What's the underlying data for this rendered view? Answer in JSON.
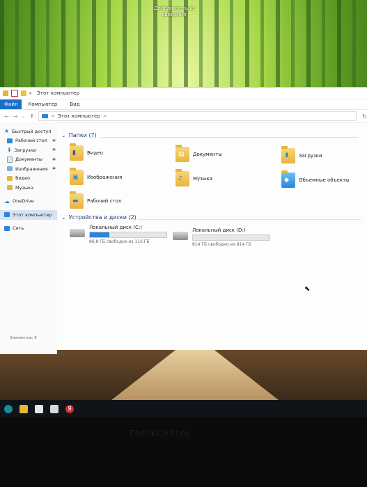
{
  "desktop": {
    "label": "Дополнительно сведения"
  },
  "window": {
    "title": "Этот компьютер",
    "ribbon": {
      "file": "Файл",
      "tabs": [
        "Компьютер",
        "Вид"
      ]
    },
    "address": {
      "path": "Этот компьютер",
      "sep": ">"
    },
    "status": "Элементов: 9"
  },
  "sidebar": {
    "quick_access": "Быстрый доступ",
    "pinned": [
      {
        "label": "Рабочий стол",
        "icon": "desktop-icon"
      },
      {
        "label": "Загрузки",
        "icon": "download-icon"
      },
      {
        "label": "Документы",
        "icon": "documents-icon"
      },
      {
        "label": "Изображения",
        "icon": "pictures-icon"
      },
      {
        "label": "Видео",
        "icon": "video-icon"
      },
      {
        "label": "Музыка",
        "icon": "music-icon"
      }
    ],
    "onedrive": "OneDrive",
    "this_pc": "Этот компьютер",
    "network": "Сеть"
  },
  "folders_section": {
    "title": "Папки (7)",
    "items": [
      "Видео",
      "Документы",
      "Загрузки",
      "Изображения",
      "Музыка",
      "Объемные объекты",
      "Рабочий стол"
    ]
  },
  "drives_section": {
    "title": "Устройства и диски (2)",
    "drives": [
      {
        "name": "Локальный диск (C:)",
        "free": "86,8 ГБ свободно из 116 ГБ",
        "used_fraction": 0.25
      },
      {
        "name": "Локальный диск (D:)",
        "free": "814 ГБ свободно из 814 ГБ",
        "used_fraction": 0.0
      }
    ]
  },
  "taskbar": {
    "yandex": "Я"
  },
  "brand": "ThinkCentre",
  "colors": {
    "accent": "#1a6fc7",
    "drive_bar": "#2a84d8"
  }
}
